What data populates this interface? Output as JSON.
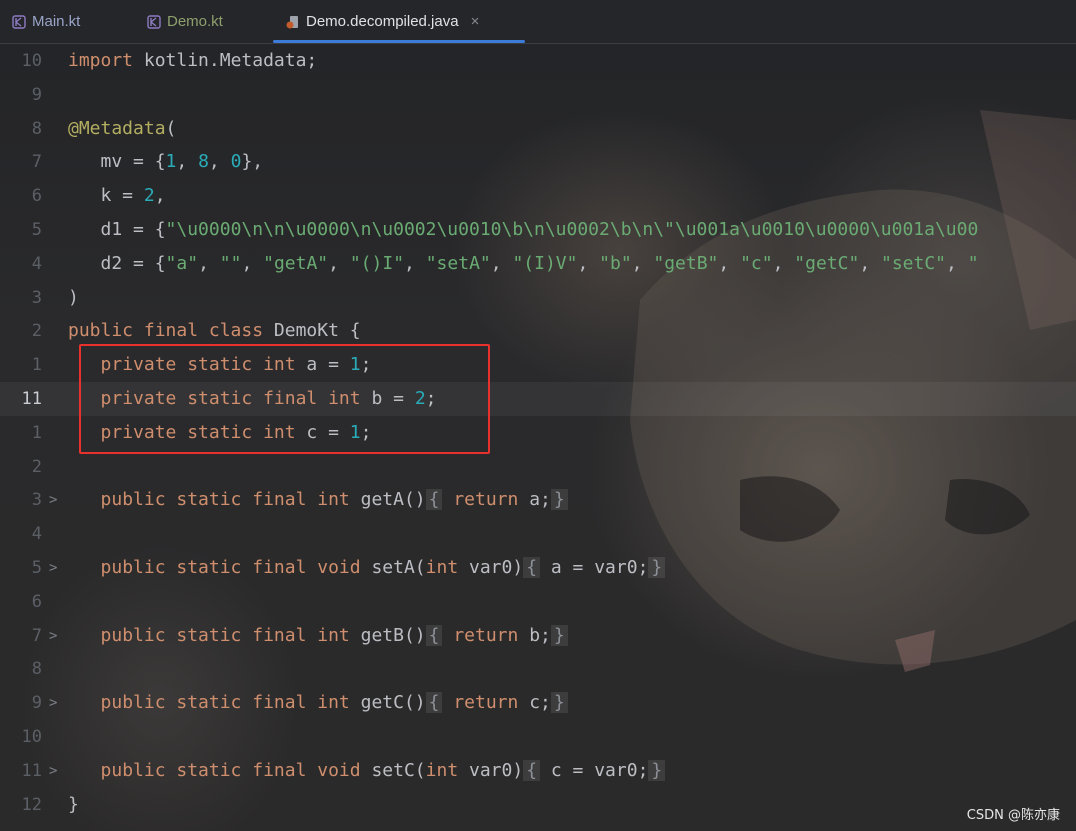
{
  "tabs": [
    {
      "label": "Main.kt",
      "icon": "kotlin-file-icon",
      "active": false
    },
    {
      "label": "Demo.kt",
      "icon": "kotlin-file-icon",
      "active": false
    },
    {
      "label": "Demo.decompiled.java",
      "icon": "java-class-icon",
      "active": true,
      "close": "×"
    }
  ],
  "editor": {
    "lines": [
      {
        "n": "10",
        "fold": "",
        "tokens": [
          [
            "kw",
            "import"
          ],
          [
            "plain",
            " kotlin.Metadata;"
          ]
        ]
      },
      {
        "n": "9",
        "fold": "",
        "tokens": []
      },
      {
        "n": "8",
        "fold": "",
        "tokens": [
          [
            "ann",
            "@Metadata"
          ],
          [
            "plain",
            "("
          ]
        ]
      },
      {
        "n": "7",
        "fold": "",
        "tokens": [
          [
            "plain",
            "   mv = {"
          ],
          [
            "num",
            "1"
          ],
          [
            "plain",
            ", "
          ],
          [
            "num",
            "8"
          ],
          [
            "plain",
            ", "
          ],
          [
            "num",
            "0"
          ],
          [
            "plain",
            "},"
          ]
        ]
      },
      {
        "n": "6",
        "fold": "",
        "tokens": [
          [
            "plain",
            "   k = "
          ],
          [
            "num",
            "2"
          ],
          [
            "plain",
            ","
          ]
        ]
      },
      {
        "n": "5",
        "fold": "",
        "tokens": [
          [
            "plain",
            "   d1 = {"
          ],
          [
            "str",
            "\"\\u0000\\n\\n\\u0000\\n\\u0002\\u0010\\b\\n\\u0002\\b\\n\\\"\\u001a\\u0010\\u0000\\u001a\\u00"
          ]
        ]
      },
      {
        "n": "4",
        "fold": "",
        "tokens": [
          [
            "plain",
            "   d2 = {"
          ],
          [
            "str",
            "\"a\""
          ],
          [
            "plain",
            ", "
          ],
          [
            "str",
            "\"\""
          ],
          [
            "plain",
            ", "
          ],
          [
            "str",
            "\"getA\""
          ],
          [
            "plain",
            ", "
          ],
          [
            "str",
            "\"()I\""
          ],
          [
            "plain",
            ", "
          ],
          [
            "str",
            "\"setA\""
          ],
          [
            "plain",
            ", "
          ],
          [
            "str",
            "\"(I)V\""
          ],
          [
            "plain",
            ", "
          ],
          [
            "str",
            "\"b\""
          ],
          [
            "plain",
            ", "
          ],
          [
            "str",
            "\"getB\""
          ],
          [
            "plain",
            ", "
          ],
          [
            "str",
            "\"c\""
          ],
          [
            "plain",
            ", "
          ],
          [
            "str",
            "\"getC\""
          ],
          [
            "plain",
            ", "
          ],
          [
            "str",
            "\"setC\""
          ],
          [
            "plain",
            ", "
          ],
          [
            "str",
            "\""
          ]
        ]
      },
      {
        "n": "3",
        "fold": "",
        "tokens": [
          [
            "plain",
            ")"
          ]
        ]
      },
      {
        "n": "2",
        "fold": "",
        "tokens": [
          [
            "kw",
            "public final class "
          ],
          [
            "plain",
            "DemoKt {"
          ]
        ]
      },
      {
        "n": "1",
        "fold": "",
        "tokens": [
          [
            "plain",
            "   "
          ],
          [
            "kw",
            "private static int "
          ],
          [
            "plain",
            "a = "
          ],
          [
            "num",
            "1"
          ],
          [
            "plain",
            ";"
          ]
        ]
      },
      {
        "n": "11",
        "fold": "",
        "current": true,
        "tokens": [
          [
            "plain",
            "   "
          ],
          [
            "kw",
            "private static final int "
          ],
          [
            "plain",
            "b = "
          ],
          [
            "num",
            "2"
          ],
          [
            "plain",
            ";"
          ]
        ]
      },
      {
        "n": "1",
        "fold": "",
        "tokens": [
          [
            "plain",
            "   "
          ],
          [
            "kw",
            "private static int "
          ],
          [
            "plain",
            "c = "
          ],
          [
            "num",
            "1"
          ],
          [
            "plain",
            ";"
          ]
        ]
      },
      {
        "n": "2",
        "fold": "",
        "tokens": []
      },
      {
        "n": "3",
        "fold": ">",
        "tokens": [
          [
            "plain",
            "   "
          ],
          [
            "kw",
            "public static final int "
          ],
          [
            "plain",
            "getA()"
          ],
          [
            "box",
            "{"
          ],
          [
            "kw",
            " return "
          ],
          [
            "plain",
            "a;"
          ],
          [
            "box",
            "}"
          ]
        ]
      },
      {
        "n": "4",
        "fold": "",
        "tokens": []
      },
      {
        "n": "5",
        "fold": ">",
        "tokens": [
          [
            "plain",
            "   "
          ],
          [
            "kw",
            "public static final void "
          ],
          [
            "plain",
            "setA("
          ],
          [
            "kw",
            "int "
          ],
          [
            "plain",
            "var0)"
          ],
          [
            "box",
            "{"
          ],
          [
            "plain",
            " a = var0;"
          ],
          [
            "box",
            "}"
          ]
        ]
      },
      {
        "n": "6",
        "fold": "",
        "tokens": []
      },
      {
        "n": "7",
        "fold": ">",
        "tokens": [
          [
            "plain",
            "   "
          ],
          [
            "kw",
            "public static final int "
          ],
          [
            "plain",
            "getB()"
          ],
          [
            "box",
            "{"
          ],
          [
            "kw",
            " return "
          ],
          [
            "plain",
            "b;"
          ],
          [
            "box",
            "}"
          ]
        ]
      },
      {
        "n": "8",
        "fold": "",
        "tokens": []
      },
      {
        "n": "9",
        "fold": ">",
        "tokens": [
          [
            "plain",
            "   "
          ],
          [
            "kw",
            "public static final int "
          ],
          [
            "plain",
            "getC()"
          ],
          [
            "box",
            "{"
          ],
          [
            "kw",
            " return "
          ],
          [
            "plain",
            "c;"
          ],
          [
            "box",
            "}"
          ]
        ]
      },
      {
        "n": "10",
        "fold": "",
        "tokens": []
      },
      {
        "n": "11",
        "fold": ">",
        "tokens": [
          [
            "plain",
            "   "
          ],
          [
            "kw",
            "public static final void "
          ],
          [
            "plain",
            "setC("
          ],
          [
            "kw",
            "int "
          ],
          [
            "plain",
            "var0)"
          ],
          [
            "box",
            "{"
          ],
          [
            "plain",
            " c = var0;"
          ],
          [
            "box",
            "}"
          ]
        ]
      },
      {
        "n": "12",
        "fold": "",
        "tokens": [
          [
            "plain",
            "}"
          ]
        ]
      }
    ]
  },
  "watermark": "CSDN @陈亦康",
  "colors": {
    "keyword": "#cf8e6d",
    "number": "#2aacb8",
    "string": "#6aab73",
    "annotation": "#b3ae60",
    "highlight_box": "#e8302c",
    "active_tab_underline": "#3d7bd9"
  }
}
